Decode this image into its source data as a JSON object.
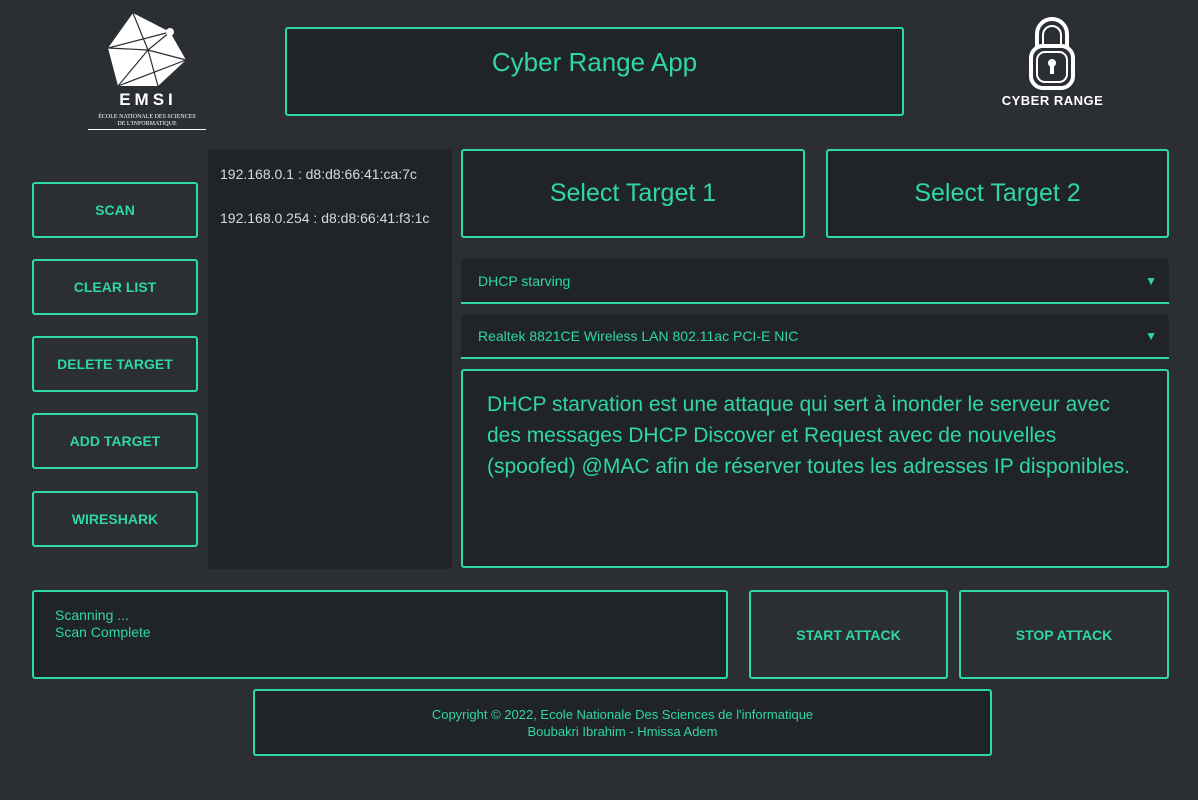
{
  "header": {
    "title": "Cyber Range App",
    "left_logo": {
      "letters": "EMSI",
      "caption_line1": "ÉCOLE NATIONALE DES SCIENCES",
      "caption_line2": "DE L'INFORMATIQUE"
    },
    "right_logo": {
      "caption": "CYBER RANGE"
    }
  },
  "sidebar": {
    "buttons": [
      {
        "label": "SCAN"
      },
      {
        "label": "CLEAR LIST"
      },
      {
        "label": "DELETE TARGET"
      },
      {
        "label": "ADD TARGET"
      },
      {
        "label": "WIRESHARK"
      }
    ]
  },
  "hosts": [
    {
      "entry": "192.168.0.1 : d8:d8:66:41:ca:7c"
    },
    {
      "entry": "192.168.0.254 : d8:d8:66:41:f3:1c"
    }
  ],
  "targets": {
    "target1_label": "Select Target 1",
    "target2_label": "Select Target 2"
  },
  "attack_select": {
    "value": "DHCP starving",
    "arrow": "▼"
  },
  "interface_select": {
    "value": "Realtek 8821CE Wireless LAN 802.11ac PCI-E NIC",
    "arrow": "▼"
  },
  "description": "DHCP starvation est une attaque qui sert à inonder le serveur avec des messages DHCP Discover et Request avec de nouvelles (spoofed) @MAC afin de réserver toutes les adresses IP disponibles.",
  "status_log": [
    "Scanning ...",
    "Scan Complete"
  ],
  "actions": {
    "start_label": "START ATTACK",
    "stop_label": "STOP ATTACK"
  },
  "footer": {
    "line1": "Copyright © 2022, Ecole Nationale Des Sciences de l'informatique",
    "line2": "Boubakri Ibrahim - Hmissa Adem"
  },
  "colors": {
    "accent": "#2ed9a8",
    "background": "#2b2e33",
    "panel": "#202427"
  }
}
